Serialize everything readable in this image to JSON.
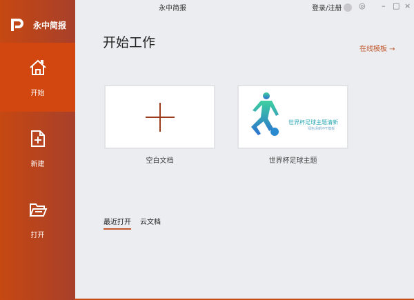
{
  "app": {
    "name": "永中简报",
    "window_title": "永中简报",
    "login": "登录/注册"
  },
  "sidebar": {
    "items": [
      {
        "label": "开始",
        "icon": "home-icon"
      },
      {
        "label": "新建",
        "icon": "new-file-icon"
      },
      {
        "label": "打开",
        "icon": "folder-open-icon"
      }
    ]
  },
  "main": {
    "heading": "开始工作",
    "online_templates": "在线模板 →",
    "cards": [
      {
        "label": "空白文档"
      },
      {
        "label": "世界杯足球主题",
        "thumb_title": "世界杯足球主题清新",
        "thumb_sub": "绿色清新PPT模板"
      }
    ],
    "tabs": [
      {
        "label": "最近打开"
      },
      {
        "label": "云文档"
      }
    ]
  },
  "colors": {
    "accent": "#c0562a",
    "sidebar": "#c64812",
    "active": "#d24710"
  }
}
